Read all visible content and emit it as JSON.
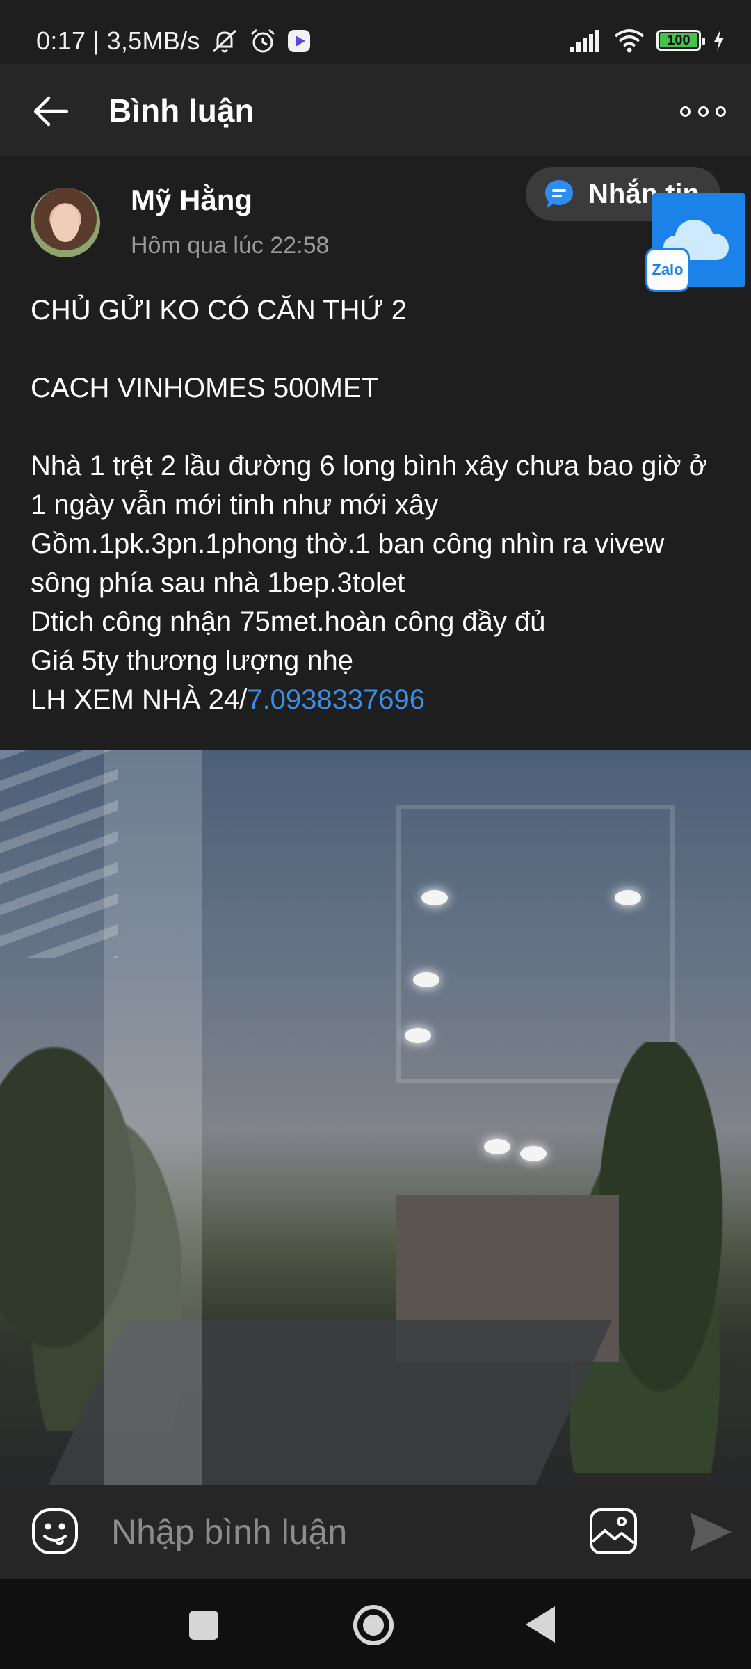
{
  "status_bar": {
    "time_speed": "0:17 | 3,5MB/s",
    "battery": "100",
    "icons": [
      "mute-bell-icon",
      "alarm-icon",
      "app-icon",
      "signal-icon",
      "wifi-icon",
      "battery-icon",
      "charging-icon"
    ]
  },
  "header": {
    "title": "Bình luận",
    "back_icon": "arrow-left-icon",
    "more_icon": "more-dots-icon"
  },
  "post": {
    "author": "Mỹ Hằng",
    "timestamp": "Hôm qua lúc 22:58",
    "message_button": "Nhắn tin",
    "zalo_label": "Zalo",
    "body": "CHỦ GỬI KO CÓ CĂN THỨ 2\n\nCACH VINHOMES 500MET\n\nNhà 1 trệt 2 lầu đường 6 long bình xây chưa bao giờ ở 1 ngày vẫn mới tinh như mới xây\nGồm.1pk.3pn.1phong thờ.1 ban công nhìn ra vivew sông phía sau nhà 1bep.3tolet\nDtich công nhận 75met.hoàn công đầy đủ\nGiá 5ty thương lượng nhẹ\nLH XEM NHÀ 24/",
    "phone_link": "7.0938337696"
  },
  "comment_bar": {
    "placeholder": "Nhập bình luận",
    "emoji_icon": "emoji-icon",
    "image_icon": "image-icon",
    "send_icon": "send-icon"
  },
  "colors": {
    "background": "#1e1e1e",
    "header": "#262626",
    "link": "#3c8ee6",
    "muted_text": "#9a9a9a"
  }
}
